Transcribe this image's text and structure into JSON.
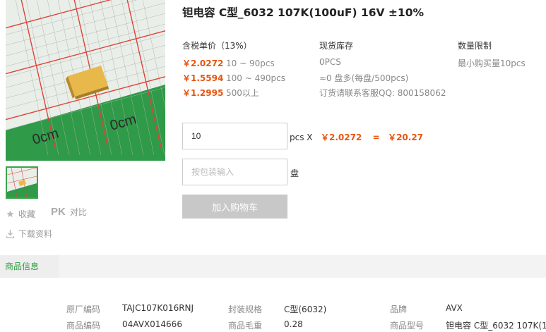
{
  "product": {
    "title": "钽电容 C型_6032 107K(100uF) 16V ±10%",
    "image_alt": "tantalum capacitor on grid"
  },
  "actions": {
    "favorite_label": "收藏",
    "compare_pk": "PK",
    "compare_label": "对比",
    "download_label": "下载资料"
  },
  "pricing": {
    "header": "含税单价（13%）",
    "tiers": [
      {
        "price": "￥2.0272",
        "range": "10 ~ 90pcs"
      },
      {
        "price": "￥1.5594",
        "range": "100 ~ 490pcs"
      },
      {
        "price": "￥1.2995",
        "range": "500以上"
      }
    ]
  },
  "stock": {
    "header": "现货库存",
    "lines": [
      "0PCS",
      "≈0 盘多(每盘/500pcs)",
      "订货请联系客服QQ: 800158062"
    ]
  },
  "limit": {
    "header": "数量限制",
    "text": "最小购买量10pcs"
  },
  "order": {
    "qty_value": "10",
    "pcs_x": "pcs X",
    "unit_price": "￥2.0272",
    "equals": "=",
    "total": "￥20.27",
    "reel_placeholder": "按包装输入",
    "reel_unit": "盘",
    "cart_label": "加入购物车"
  },
  "tabs": {
    "active": "商品信息"
  },
  "attributes": {
    "row1": [
      {
        "key": "原厂编码",
        "value": "TAJC107K016RNJ"
      },
      {
        "key": "封装规格",
        "value": "C型(6032)"
      },
      {
        "key": "品牌",
        "value": "AVX"
      }
    ],
    "row2": [
      {
        "key": "商品编码",
        "value": "04AVX014666"
      },
      {
        "key": "商品毛重",
        "value": "0.28"
      },
      {
        "key": "商品型号",
        "value": "钽电容 C型_6032 107K(1..."
      }
    ]
  },
  "colors": {
    "accent_green": "#2e9e3e",
    "price_orange": "#e8540e",
    "grid_red": "#e0433a"
  },
  "icons": [
    "star-icon",
    "download-icon"
  ]
}
